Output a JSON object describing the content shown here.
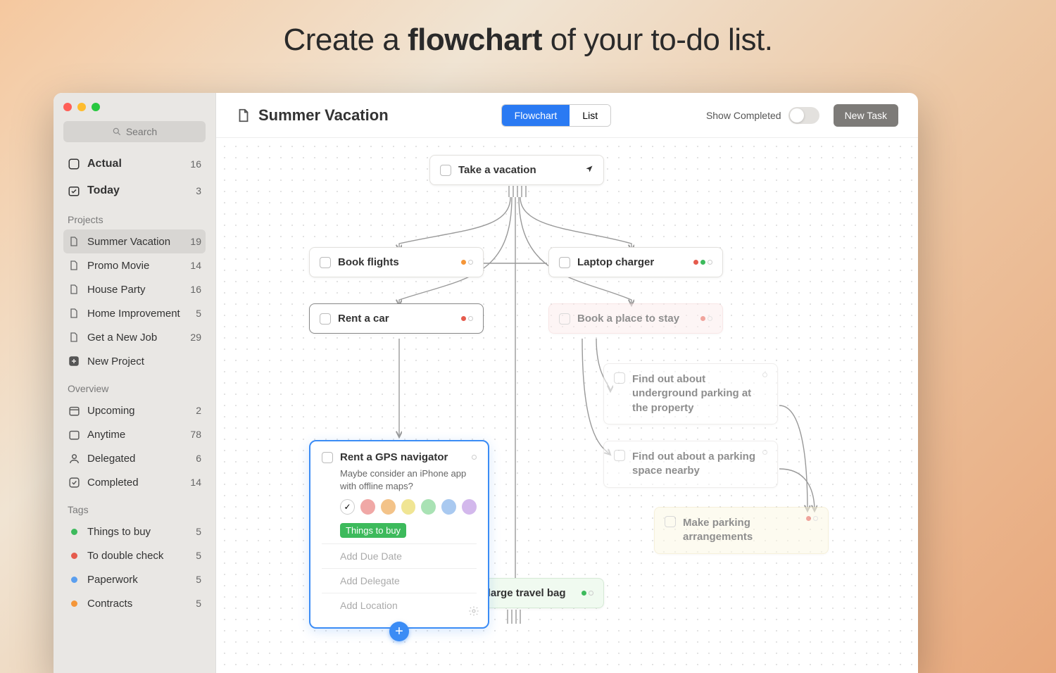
{
  "headline": {
    "pre": "Create a ",
    "bold": "flowchart",
    "post": " of your to-do list."
  },
  "sidebar": {
    "search_placeholder": "Search",
    "actual": {
      "label": "Actual",
      "count": "16"
    },
    "today": {
      "label": "Today",
      "count": "3"
    },
    "projects_label": "Projects",
    "projects": [
      {
        "label": "Summer Vacation",
        "count": "19",
        "active": true
      },
      {
        "label": "Promo Movie",
        "count": "14"
      },
      {
        "label": "House Party",
        "count": "16"
      },
      {
        "label": "Home Improvement",
        "count": "5"
      },
      {
        "label": "Get a New Job",
        "count": "29"
      }
    ],
    "new_project": "New Project",
    "overview_label": "Overview",
    "overview": [
      {
        "label": "Upcoming",
        "count": "2",
        "icon": "calendar"
      },
      {
        "label": "Anytime",
        "count": "78",
        "icon": "calendar-blank"
      },
      {
        "label": "Delegated",
        "count": "6",
        "icon": "person"
      },
      {
        "label": "Completed",
        "count": "14",
        "icon": "check-square"
      }
    ],
    "tags_label": "Tags",
    "tags": [
      {
        "label": "Things to buy",
        "count": "5",
        "color": "green"
      },
      {
        "label": "To double check",
        "count": "5",
        "color": "red"
      },
      {
        "label": "Paperwork",
        "count": "5",
        "color": "blue"
      },
      {
        "label": "Contracts",
        "count": "5",
        "color": "orange"
      }
    ]
  },
  "topbar": {
    "title": "Summer Vacation",
    "tabs": {
      "flowchart": "Flowchart",
      "list": "List"
    },
    "show_completed": "Show Completed",
    "new_task": "New Task"
  },
  "nodes": {
    "root": "Take a vacation",
    "flights": "Book flights",
    "laptop": "Laptop charger",
    "rentcar": "Rent a car",
    "stay": "Book a place to stay",
    "underground": "Find out about underground parking at the property",
    "nearby": "Find out about a parking space nearby",
    "arrange": "Make parking arrangements",
    "bag": "Get a large travel bag"
  },
  "expanded": {
    "title": "Rent a GPS navigator",
    "note": "Maybe consider an iPhone app with offline maps?",
    "tag": "Things to buy",
    "colors": [
      "#f0a8a6",
      "#f3c389",
      "#f0e594",
      "#a9e2b4",
      "#a9c9f0",
      "#d3b8ec"
    ],
    "fields": {
      "due": "Add Due Date",
      "delegate": "Add Delegate",
      "location": "Add Location"
    }
  }
}
